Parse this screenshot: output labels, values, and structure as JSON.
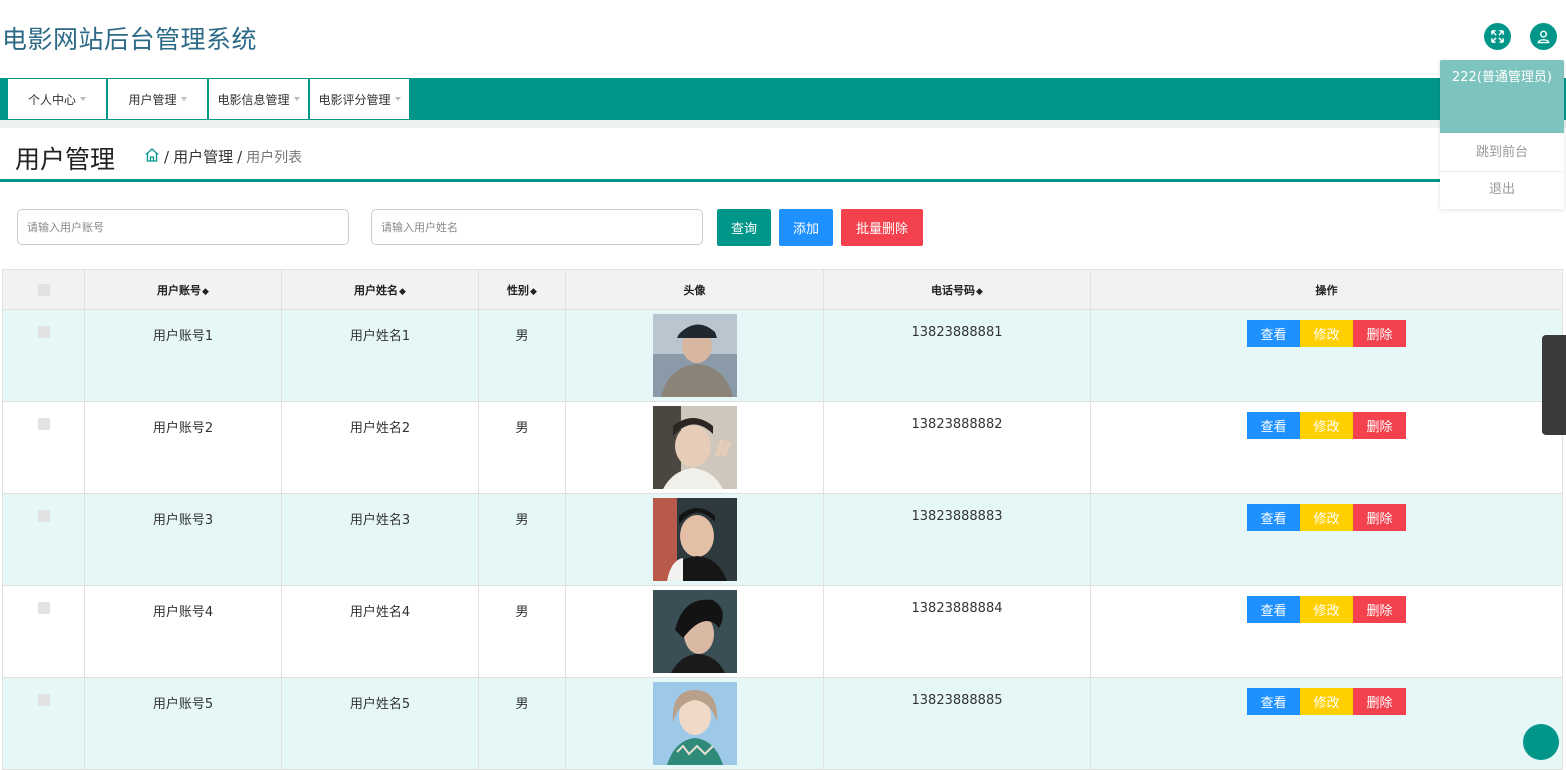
{
  "app": {
    "title": "电影网站后台管理系统"
  },
  "nav": {
    "items": [
      {
        "label": "个人中心"
      },
      {
        "label": "用户管理"
      },
      {
        "label": "电影信息管理"
      },
      {
        "label": "电影评分管理"
      }
    ]
  },
  "page": {
    "title": "用户管理",
    "breadcrumb": [
      "用户管理",
      "用户列表"
    ]
  },
  "search": {
    "account_placeholder": "请输入用户账号",
    "name_placeholder": "请输入用户姓名",
    "query_label": "查询",
    "add_label": "添加",
    "batch_delete_label": "批量删除"
  },
  "table": {
    "headers": {
      "account": "用户账号",
      "name": "用户姓名",
      "gender": "性别",
      "avatar": "头像",
      "phone": "电话号码",
      "actions": "操作"
    },
    "rows": [
      {
        "account": "用户账号1",
        "name": "用户姓名1",
        "gender": "男",
        "phone": "13823888881"
      },
      {
        "account": "用户账号2",
        "name": "用户姓名2",
        "gender": "男",
        "phone": "13823888882"
      },
      {
        "account": "用户账号3",
        "name": "用户姓名3",
        "gender": "男",
        "phone": "13823888883"
      },
      {
        "account": "用户账号4",
        "name": "用户姓名4",
        "gender": "男",
        "phone": "13823888884"
      },
      {
        "account": "用户账号5",
        "name": "用户姓名5",
        "gender": "男",
        "phone": "13823888885"
      }
    ],
    "row_actions": {
      "view": "查看",
      "edit": "修改",
      "delete": "删除"
    }
  },
  "user_menu": {
    "user_label": "222(普通管理员)",
    "goto_front": "跳到前台",
    "logout": "退出"
  },
  "colors": {
    "primary": "#00968a",
    "blue": "#1e90ff",
    "yellow": "#ffd000",
    "red": "#f3414d",
    "row_tint": "#e6f7f8"
  },
  "icons": {
    "fullscreen": "fullscreen-icon",
    "user": "user-icon",
    "home": "home-icon",
    "sort": "sort-icon"
  }
}
